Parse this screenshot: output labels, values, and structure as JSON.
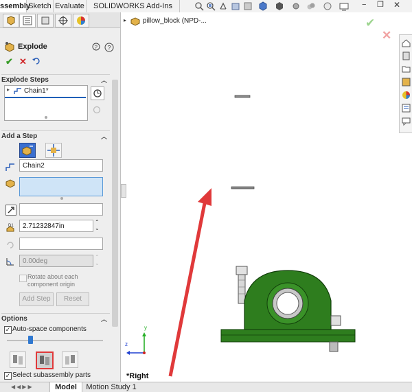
{
  "top_tabs": [
    "ssembly",
    "Sketch",
    "Evaluate",
    "SOLIDWORKS Add-Ins"
  ],
  "tree": {
    "item": "pillow_block  (NPD-..."
  },
  "feature": {
    "title": "Explode"
  },
  "explode_steps": {
    "header": "Explode Steps",
    "items": [
      "Chain1*"
    ]
  },
  "add_step": {
    "header": "Add a Step",
    "name_value": "Chain2",
    "distance_value": "2.71232847in",
    "angle_value": "0.00deg",
    "rotate_label_1": "Rotate about each",
    "rotate_label_2": "component origin",
    "add_button": "Add Step",
    "reset_button": "Reset"
  },
  "options": {
    "header": "Options",
    "auto_space": "Auto-space components",
    "select_sub": "Select subassembly parts"
  },
  "view": {
    "label": "*Right"
  },
  "bottom_tabs": [
    "Model",
    "Motion Study 1"
  ],
  "colors": {
    "accent": "#1f5fb8",
    "part_green": "#2e7d1e",
    "arrow_red": "#e0393a",
    "ok_green": "#3a9d2a",
    "cancel_red": "#d0282a"
  }
}
